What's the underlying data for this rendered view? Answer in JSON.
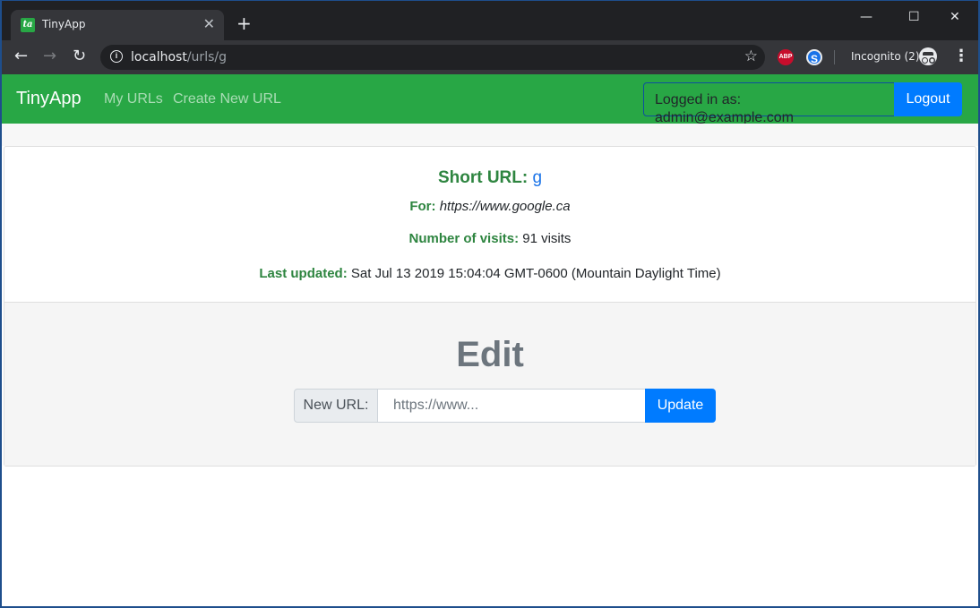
{
  "browser": {
    "tab_title": "TinyApp",
    "tab_favicon_text": "ta",
    "tab_close": "✕",
    "new_tab": "+",
    "url_host": "localhost",
    "url_path": "/urls/g",
    "incognito_label": "Incognito (2)",
    "abp_label": "ABP",
    "s_label": "S",
    "window_controls": {
      "minimize": "—",
      "maximize": "☐",
      "close": "✕"
    }
  },
  "navbar": {
    "brand": "TinyApp",
    "links": [
      {
        "label": "My URLs"
      },
      {
        "label": "Create New URL"
      }
    ],
    "logged_in_text": "Logged in as: admin@example.com",
    "logout_label": "Logout",
    "color": "#28a745"
  },
  "details": {
    "short_url_label": "Short URL:",
    "short_url_value": "g",
    "for_label": "For:",
    "for_value": "https://www.google.ca",
    "visits_label": "Number of visits:",
    "visits_value": "91 visits",
    "updated_label": "Last updated:",
    "updated_value": "Sat Jul 13 2019 15:04:04 GMT-0600 (Mountain Daylight Time)"
  },
  "edit": {
    "title": "Edit",
    "prepend_label": "New URL:",
    "input_placeholder": "https://www...",
    "input_value": "",
    "update_label": "Update",
    "accent": "#007bff"
  }
}
